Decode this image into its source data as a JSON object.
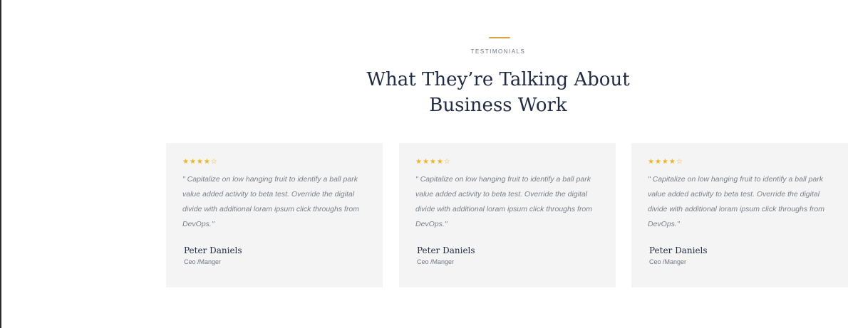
{
  "section": {
    "eyebrow": "TESTIMONIALS",
    "title_line1": "What They’re Talking About",
    "title_line2": "Business Work"
  },
  "colors": {
    "accent": "#d9a441",
    "star": "#f1b420",
    "heading": "#1f2a44",
    "card_bg": "#f4f4f4"
  },
  "testimonials": [
    {
      "stars": "★★★★☆",
      "rating": 4,
      "quote": "\" Capitalize on low hanging fruit to identify a ball park value added activity to beta test. Override the digital divide with additional loram ipsum click throughs from DevOps.\"",
      "name": "Peter Daniels",
      "role": "Ceo /Manger"
    },
    {
      "stars": "★★★★☆",
      "rating": 4,
      "quote": "\" Capitalize on low hanging fruit to identify a ball park value added activity to beta test. Override the digital divide with additional loram ipsum click throughs from DevOps.\"",
      "name": "Peter Daniels",
      "role": "Ceo /Manger"
    },
    {
      "stars": "★★★★☆",
      "rating": 4,
      "quote": "\" Capitalize on low hanging fruit to identify a ball park value added activity to beta test. Override the digital divide with additional loram ipsum click throughs from DevOps.\"",
      "name": "Peter Daniels",
      "role": "Ceo /Manger"
    }
  ]
}
